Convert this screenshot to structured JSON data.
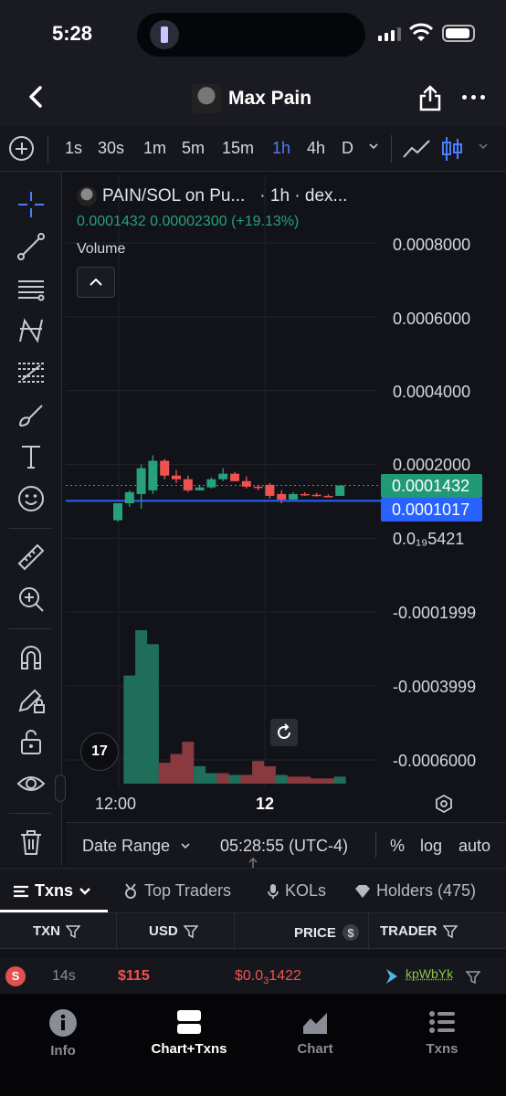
{
  "status": {
    "time": "5:28"
  },
  "header": {
    "title": "Max Pain"
  },
  "timeframes": [
    {
      "label": "1s",
      "active": false
    },
    {
      "label": "30s",
      "active": false
    },
    {
      "label": "1m",
      "active": false
    },
    {
      "label": "5m",
      "active": false
    },
    {
      "label": "15m",
      "active": false
    },
    {
      "label": "1h",
      "active": true
    },
    {
      "label": "4h",
      "active": false
    },
    {
      "label": "D",
      "active": false
    }
  ],
  "chart": {
    "pair_label": "PAIN/SOL on Pu...",
    "interval_label": "· 1h · dex...",
    "last_price": "0.0001432",
    "change_abs": "0.00002300",
    "change_pct": "(+19.13%)",
    "volume_label": "Volume",
    "price_tag": "0.0001432",
    "line_tag": "0.0001017",
    "tv_logo": "17",
    "colors": {
      "up": "#26a17b",
      "down": "#ef5350",
      "line": "#2962ff"
    }
  },
  "chart_data": {
    "type": "candlestick",
    "y_axis_labels": [
      "0.0008000",
      "0.0006000",
      "0.0004000",
      "0.0002000",
      "0.0₁₉5421",
      "-0.0001999",
      "-0.0003999",
      "-0.0006000"
    ],
    "x_axis_labels": [
      "12:00",
      "12"
    ],
    "ylim": [
      -0.0006,
      0.0008
    ],
    "candles": [
      {
        "o": 4.9e-05,
        "h": 9.5e-05,
        "l": 4.5e-05,
        "c": 9.5e-05
      },
      {
        "o": 9.5e-05,
        "h": 0.00013,
        "l": 8.5e-05,
        "c": 0.000125
      },
      {
        "o": 0.00012,
        "h": 0.0002,
        "l": 8e-05,
        "c": 0.00019
      },
      {
        "o": 0.00013,
        "h": 0.000225,
        "l": 0.00012,
        "c": 0.00021
      },
      {
        "o": 0.00021,
        "h": 0.000215,
        "l": 0.00016,
        "c": 0.00017
      },
      {
        "o": 0.00017,
        "h": 0.000185,
        "l": 0.00015,
        "c": 0.00016
      },
      {
        "o": 0.00016,
        "h": 0.00017,
        "l": 0.000125,
        "c": 0.00013
      },
      {
        "o": 0.00013,
        "h": 0.000145,
        "l": 0.00013,
        "c": 0.000138
      },
      {
        "o": 0.000138,
        "h": 0.000165,
        "l": 0.000135,
        "c": 0.00016
      },
      {
        "o": 0.00016,
        "h": 0.00019,
        "l": 0.000155,
        "c": 0.000175
      },
      {
        "o": 0.000175,
        "h": 0.00018,
        "l": 0.000155,
        "c": 0.000155
      },
      {
        "o": 0.000155,
        "h": 0.000168,
        "l": 0.000135,
        "c": 0.00014
      },
      {
        "o": 0.00014,
        "h": 0.000145,
        "l": 0.00013,
        "c": 0.000138
      },
      {
        "o": 0.000145,
        "h": 0.00015,
        "l": 0.000108,
        "c": 0.000115
      },
      {
        "o": 0.00012,
        "h": 0.00013,
        "l": 9.5e-05,
        "c": 0.000105
      },
      {
        "o": 0.000105,
        "h": 0.000125,
        "l": 0.000105,
        "c": 0.00012
      },
      {
        "o": 0.00012,
        "h": 0.000125,
        "l": 0.000115,
        "c": 0.000118
      },
      {
        "o": 0.000118,
        "h": 0.000123,
        "l": 0.000113,
        "c": 0.000115
      },
      {
        "o": 0.000115,
        "h": 0.000119,
        "l": 0.000112,
        "c": 0.000114
      },
      {
        "o": 0.000115,
        "h": 0.000144,
        "l": 0.000115,
        "c": 0.0001432
      }
    ],
    "volumes": [
      0,
      0.62,
      0.88,
      0.8,
      0.12,
      0.17,
      0.24,
      0.1,
      0.06,
      0.06,
      0.05,
      0.05,
      0.13,
      0.1,
      0.05,
      0.04,
      0.04,
      0.03,
      0.03,
      0.04
    ],
    "volume_up": [
      false,
      true,
      true,
      true,
      false,
      false,
      false,
      true,
      true,
      false,
      true,
      false,
      false,
      false,
      true,
      false,
      false,
      false,
      false,
      true
    ],
    "horizontal_line": 0.0001017
  },
  "controls": {
    "date_range": "Date Range",
    "time": "05:28:55 (UTC-4)",
    "percent": "%",
    "log": "log",
    "auto": "auto"
  },
  "tabs": {
    "txns": "Txns",
    "top_traders": "Top Traders",
    "kols": "KOLs",
    "holders": "Holders (475)"
  },
  "table": {
    "headers": {
      "txn": "TXN",
      "usd": "USD",
      "price": "PRICE",
      "trader": "TRADER"
    },
    "row": {
      "side": "S",
      "age": "14s",
      "usd": "$115",
      "price_prefix": "$0.0",
      "price_zeros": "3",
      "price_rest": "1422",
      "trader": "kpWbYk"
    }
  },
  "nav": {
    "info": "Info",
    "chart_txns": "Chart+Txns",
    "chart": "Chart",
    "txns": "Txns"
  }
}
